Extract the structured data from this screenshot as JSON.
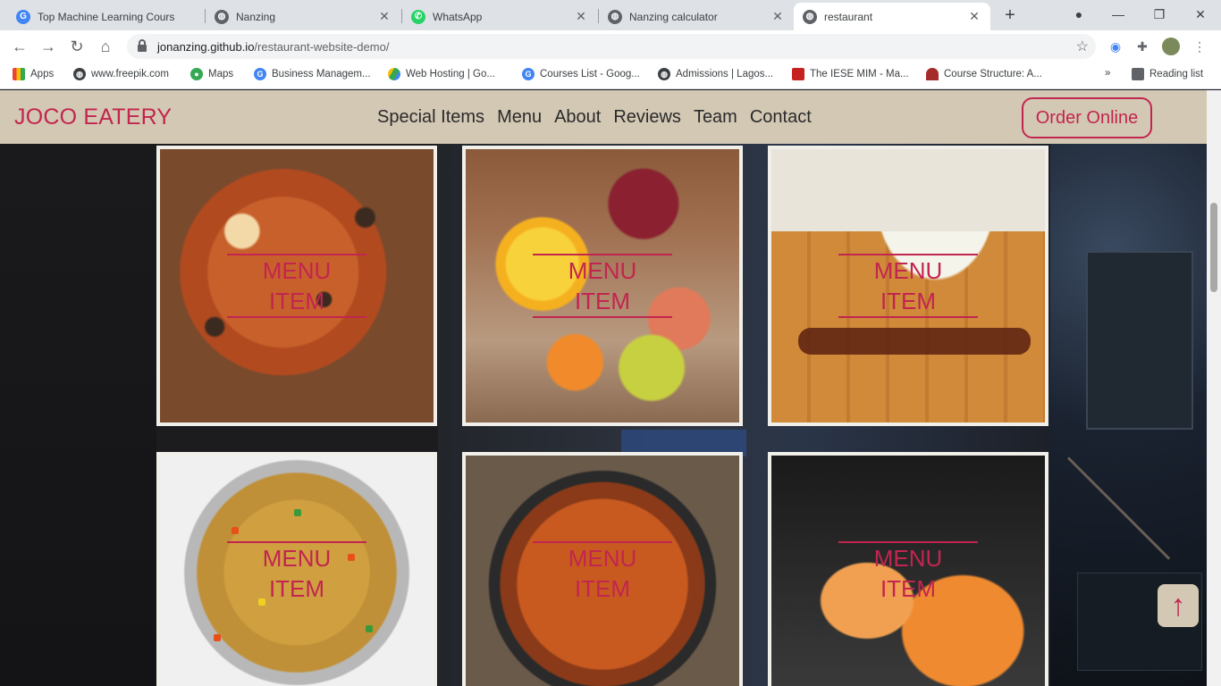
{
  "browser": {
    "tabs": [
      {
        "title": "Top Machine Learning Cours",
        "favicon": "google-icon",
        "active": false
      },
      {
        "title": "Nanzing",
        "favicon": "globe-icon",
        "active": false
      },
      {
        "title": "WhatsApp",
        "favicon": "whatsapp-icon",
        "active": false
      },
      {
        "title": "Nanzing calculator",
        "favicon": "globe-icon",
        "active": false
      },
      {
        "title": "restaurant",
        "favicon": "globe-icon",
        "active": true
      }
    ],
    "url_host": "jonanzing.github.io",
    "url_path": "/restaurant-website-demo/",
    "bookmarks": [
      {
        "label": "Apps",
        "icon": "apps-grid-icon"
      },
      {
        "label": "www.freepik.com",
        "icon": "globe-icon"
      },
      {
        "label": "Maps",
        "icon": "maps-pin-icon"
      },
      {
        "label": "Business Managem...",
        "icon": "google-icon"
      },
      {
        "label": "Web Hosting | Go...",
        "icon": "google-drive-icon"
      },
      {
        "label": "Courses List - Goog...",
        "icon": "google-icon"
      },
      {
        "label": "Admissions | Lagos...",
        "icon": "globe-icon"
      },
      {
        "label": "The IESE MIM - Ma...",
        "icon": "iese-icon"
      },
      {
        "label": "Course Structure: A...",
        "icon": "arch-icon"
      }
    ],
    "reading_list": "Reading list"
  },
  "site": {
    "brand": "JOCO EATERY",
    "nav": [
      "Special Items",
      "Menu",
      "About",
      "Reviews",
      "Team",
      "Contact"
    ],
    "order_button": "Order Online",
    "menu_cards": [
      {
        "line1": "MENU",
        "line2": "ITEM",
        "photo": "pizza"
      },
      {
        "line1": "MENU",
        "line2": "ITEM",
        "photo": "fruit-juice"
      },
      {
        "line1": "MENU",
        "line2": "ITEM",
        "photo": "chicken-cutlet"
      },
      {
        "line1": "MENU",
        "line2": "ITEM",
        "photo": "fried-rice"
      },
      {
        "line1": "MENU",
        "line2": "ITEM",
        "photo": "minestrone-soup"
      },
      {
        "line1": "MENU",
        "line2": "ITEM",
        "photo": "cocktail-drink"
      }
    ],
    "scroll_top_icon": "arrow-up-icon",
    "accent_color": "#c2254f",
    "navbar_color": "#d3c8b4"
  }
}
